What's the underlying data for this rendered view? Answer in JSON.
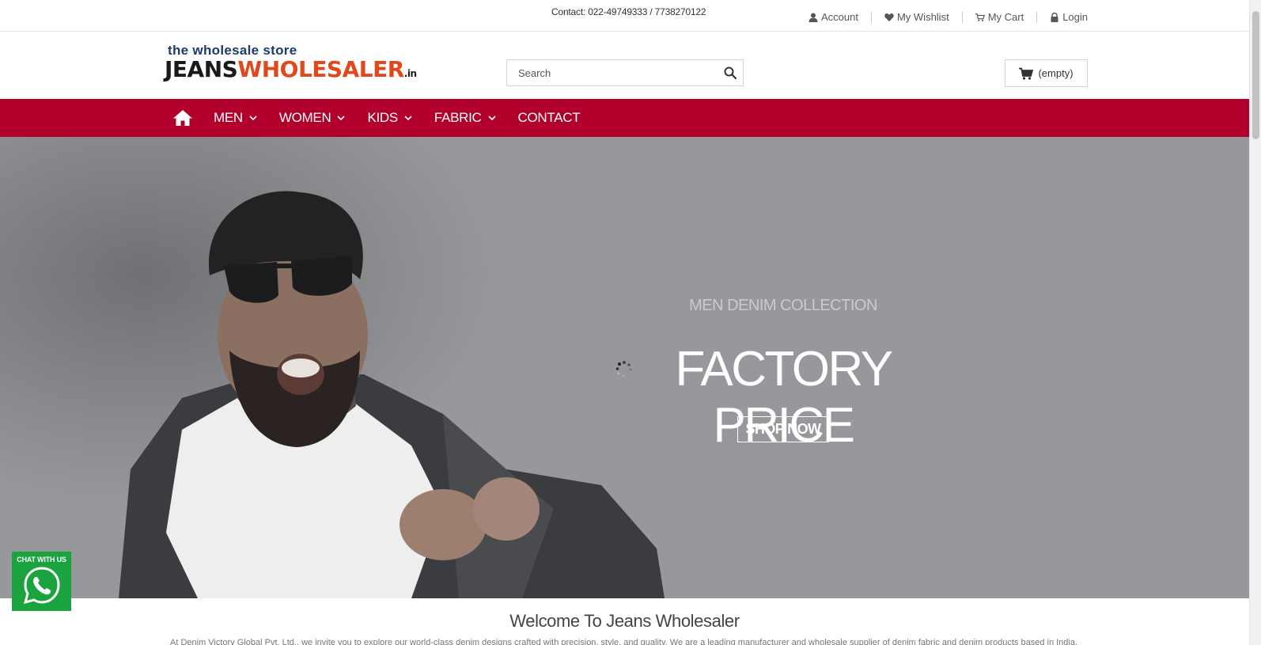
{
  "topbar": {
    "contact": "Contact: 022-49749333 / 7738270122",
    "links": [
      {
        "label": "Account",
        "icon": "user-icon"
      },
      {
        "label": "My Wishlist",
        "icon": "heart-icon"
      },
      {
        "label": "My Cart",
        "icon": "cart-icon"
      },
      {
        "label": "Login",
        "icon": "lock-icon"
      }
    ]
  },
  "header": {
    "logo_tagline": "the wholesale store",
    "logo_part1": "JEANS",
    "logo_part2": "WHOLESALER",
    "logo_tld": ".in",
    "search_placeholder": "Search",
    "cart_label": "(empty)"
  },
  "nav": {
    "items": [
      {
        "label": "MEN",
        "dropdown": true
      },
      {
        "label": "WOMEN",
        "dropdown": true
      },
      {
        "label": "KIDS",
        "dropdown": true
      },
      {
        "label": "FABRIC",
        "dropdown": true
      },
      {
        "label": "CONTACT",
        "dropdown": false
      }
    ]
  },
  "hero": {
    "subtitle": "MEN DENIM COLLECTION",
    "title": "FACTORY PRICE",
    "button": "SHOP NOW"
  },
  "welcome": {
    "heading": "Welcome To Jeans Wholesaler",
    "text": "At Denim Victory Global Pvt. Ltd., we invite you to explore our world-class denim designs crafted with precision, style, and quality. We are a leading manufacturer and wholesale supplier of denim fabric and denim products based in India. Our extensive"
  },
  "whatsapp": {
    "label": "CHAT WITH US"
  },
  "colors": {
    "nav_bg": "#b0002b",
    "hero_bg": "#96989b",
    "whatsapp": "#1aa33e",
    "logo_orange": "#e0491c",
    "logo_navy": "#1d3b6e"
  }
}
